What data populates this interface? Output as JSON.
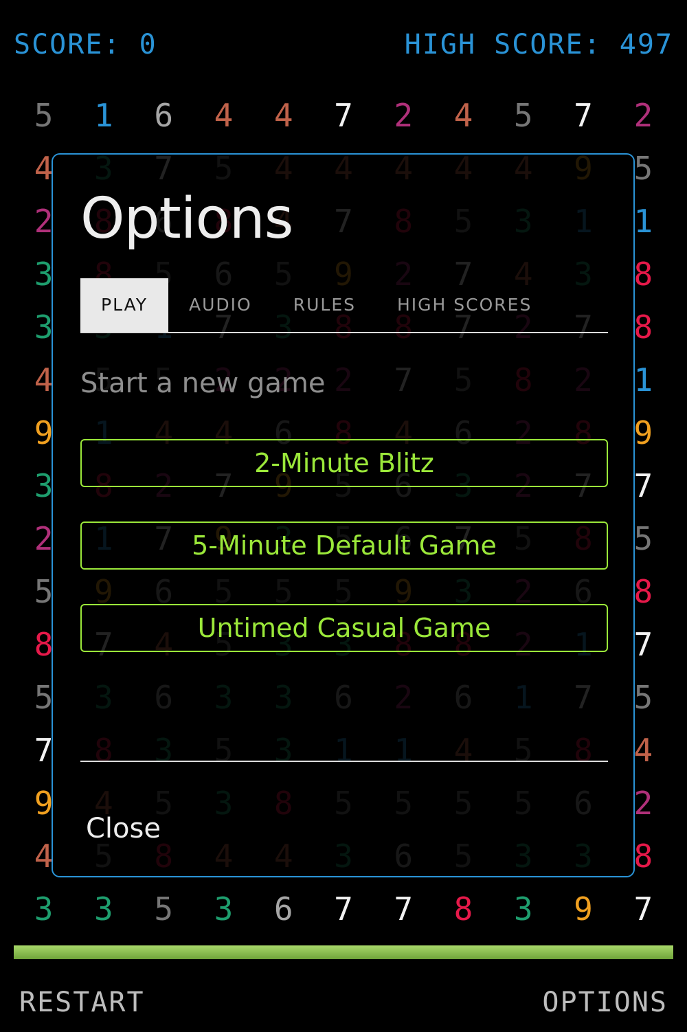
{
  "hud": {
    "score_label": "SCORE: 0",
    "high_score_label": "HIGH SCORE: 497"
  },
  "colors": {
    "1": "#2a93d6",
    "2": "#b0307a",
    "3": "#1e9e6e",
    "4": "#c0624a",
    "5": "#767676",
    "6": "#a6a6a6",
    "7": "#f2f2f2",
    "8": "#e6194a",
    "9": "#f0a020"
  },
  "grid": [
    [
      5,
      1,
      6,
      4,
      4,
      7,
      2,
      4,
      5,
      7,
      2
    ],
    [
      4,
      3,
      7,
      5,
      4,
      4,
      4,
      4,
      4,
      9,
      5
    ],
    [
      2,
      8,
      6,
      8,
      4,
      7,
      8,
      5,
      3,
      1,
      1
    ],
    [
      3,
      8,
      5,
      6,
      5,
      9,
      2,
      7,
      4,
      3,
      8
    ],
    [
      3,
      3,
      1,
      7,
      3,
      8,
      8,
      7,
      2,
      7,
      8
    ],
    [
      4,
      5,
      5,
      2,
      2,
      2,
      7,
      5,
      8,
      2,
      1
    ],
    [
      9,
      1,
      4,
      4,
      6,
      8,
      4,
      6,
      2,
      8,
      9
    ],
    [
      3,
      8,
      2,
      7,
      9,
      5,
      6,
      3,
      2,
      7,
      7
    ],
    [
      2,
      1,
      7,
      9,
      3,
      5,
      6,
      7,
      5,
      8,
      5
    ],
    [
      5,
      9,
      6,
      5,
      5,
      5,
      9,
      3,
      2,
      6,
      8
    ],
    [
      8,
      7,
      4,
      5,
      3,
      3,
      8,
      8,
      2,
      1,
      7
    ],
    [
      5,
      3,
      6,
      3,
      3,
      6,
      2,
      6,
      1,
      7,
      5
    ],
    [
      7,
      8,
      3,
      5,
      3,
      1,
      1,
      4,
      5,
      8,
      4
    ],
    [
      9,
      4,
      5,
      3,
      8,
      5,
      5,
      5,
      5,
      6,
      2
    ],
    [
      4,
      5,
      8,
      4,
      4,
      3,
      6,
      5,
      3,
      3,
      8
    ],
    [
      3,
      3,
      5,
      3,
      6,
      7,
      7,
      8,
      3,
      9,
      7
    ]
  ],
  "timer_progress": 1.0,
  "footer": {
    "restart_label": "RESTART",
    "options_label": "OPTIONS"
  },
  "modal": {
    "title": "Options",
    "tabs": [
      {
        "label": "PLAY",
        "active": true
      },
      {
        "label": "AUDIO",
        "active": false
      },
      {
        "label": "RULES",
        "active": false
      },
      {
        "label": "HIGH SCORES",
        "active": false
      }
    ],
    "subtitle": "Start a new game",
    "buttons": [
      "2-Minute Blitz",
      "5-Minute Default Game",
      "Untimed Casual Game"
    ],
    "close_label": "Close"
  }
}
